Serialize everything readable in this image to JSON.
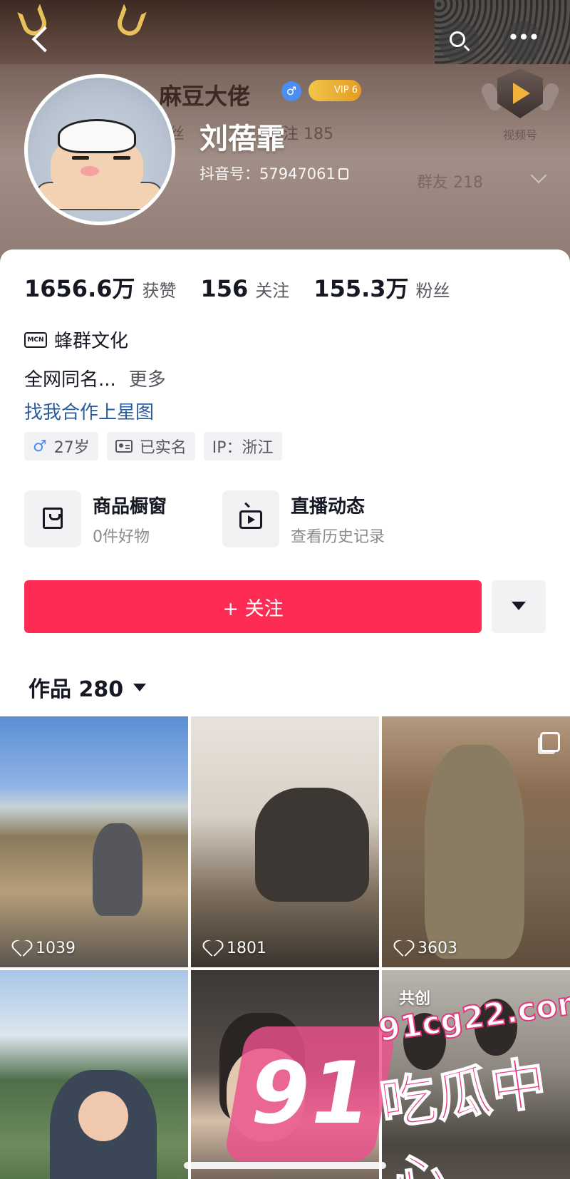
{
  "header": {
    "username_banner": "麻豆大佬",
    "vip_level": "VIP 6",
    "banner_fans_label": "粉丝",
    "banner_following_label": "关注",
    "banner_following_count": "185",
    "banner_row3": "抖音号: 5794",
    "banner_group_label": "群友 218",
    "display_name": "刘蓓霏",
    "douyin_id": "抖音号：57947061",
    "channel_label": "视频号"
  },
  "stats": [
    {
      "num": "1656.6万",
      "label": "获赞"
    },
    {
      "num": "156",
      "label": "关注"
    },
    {
      "num": "155.3万",
      "label": "粉丝"
    }
  ],
  "mcn": {
    "icon_text": "MCN",
    "name": "蜂群文化"
  },
  "bio": {
    "text": "全网同名...",
    "more": "更多"
  },
  "star_link": "找我合作上星图",
  "tags": {
    "age": "27岁",
    "verified": "已实名",
    "ip": "IP：浙江"
  },
  "features": [
    {
      "title": "商品橱窗",
      "sub": "0件好物",
      "icon": "bag-icon"
    },
    {
      "title": "直播动态",
      "sub": "查看历史记录",
      "icon": "tv-icon"
    }
  ],
  "actions": {
    "follow": "+ 关注"
  },
  "works": {
    "label": "作品 280"
  },
  "videos": [
    {
      "likes": "1039"
    },
    {
      "likes": "1801"
    },
    {
      "likes": "3603"
    },
    {
      "likes": ""
    },
    {
      "likes": ""
    },
    {
      "likes": "",
      "tag": "共创"
    }
  ],
  "watermark": {
    "big": "91",
    "url": "91cg22.com",
    "cn": "吃瓜中心"
  },
  "colors": {
    "accent": "#fe2c55",
    "link": "#2b5c9b",
    "male": "#4a8ef1"
  }
}
